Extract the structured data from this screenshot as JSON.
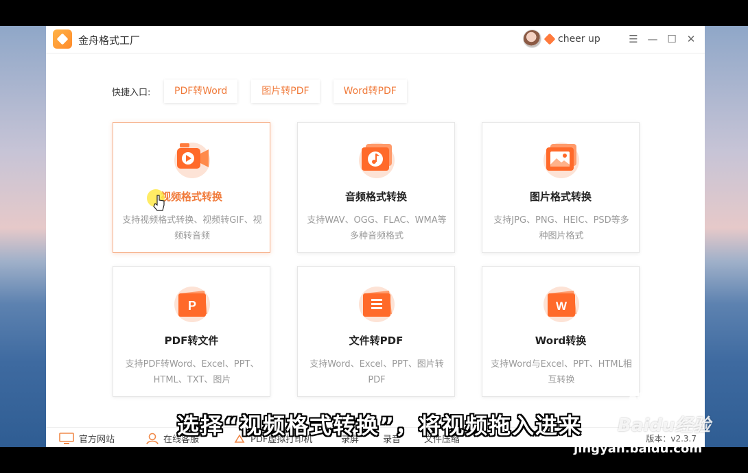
{
  "app": {
    "title": "金舟格式工厂"
  },
  "user": {
    "name": "cheer up"
  },
  "window_controls": {
    "menu": "☰",
    "minimize": "—",
    "maximize": "☐",
    "close": "✕"
  },
  "quick": {
    "label": "快捷入口:",
    "items": [
      "PDF转Word",
      "图片转PDF",
      "Word转PDF"
    ]
  },
  "cards": [
    {
      "title": "视频格式转换",
      "desc": "支持视频格式转换、视频转GIF、视频转音频",
      "icon": "video-camera-icon"
    },
    {
      "title": "音频格式转换",
      "desc": "支持WAV、OGG、FLAC、WMA等多种音频格式",
      "icon": "music-note-icon"
    },
    {
      "title": "图片格式转换",
      "desc": "支持JPG、PNG、HEIC、PSD等多种图片格式",
      "icon": "image-icon"
    },
    {
      "title": "PDF转文件",
      "desc": "支持PDF转Word、Excel、PPT、HTML、TXT、图片",
      "icon": "ppt-file-icon"
    },
    {
      "title": "文件转PDF",
      "desc": "支持Word、Excel、PPT、图片转PDF",
      "icon": "document-lines-icon"
    },
    {
      "title": "Word转换",
      "desc": "支持Word与Excel、PPT、HTML相互转换",
      "icon": "word-file-icon"
    }
  ],
  "bottom": {
    "items": [
      "官方网站",
      "在线客服",
      "PDF虚拟打印机",
      "录屏",
      "录音",
      "文件压缩"
    ],
    "version": "版本：v2.3.7"
  },
  "subtitle": "选择“视频格式转换”，将视频拖入进来",
  "watermark": {
    "brand": "Baidu经验",
    "url": "jingyan.baidu.com"
  },
  "colors": {
    "accent": "#f07a3a",
    "accent_light": "#f6b08a"
  }
}
